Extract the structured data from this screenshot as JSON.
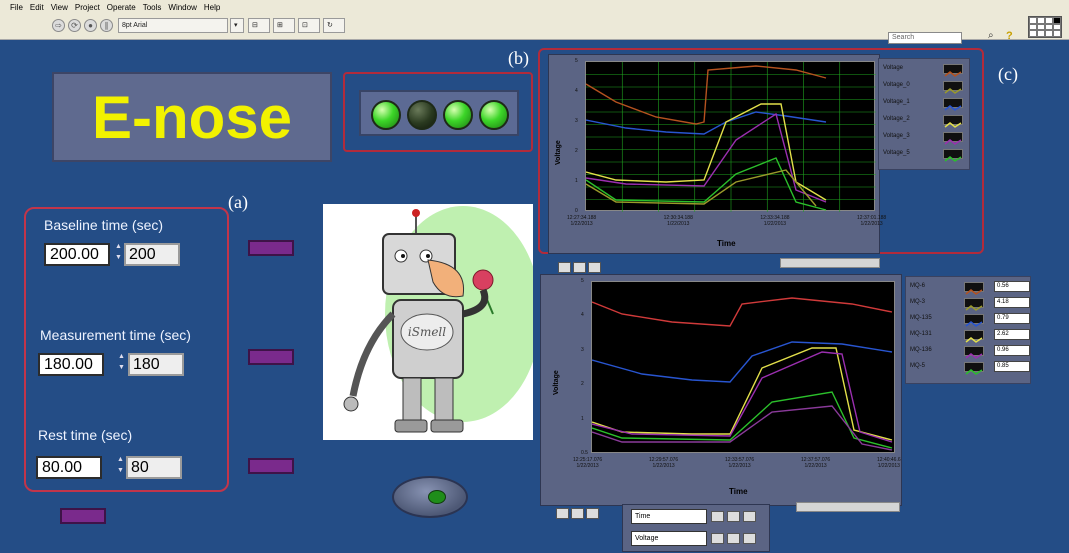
{
  "menu": [
    "File",
    "Edit",
    "View",
    "Project",
    "Operate",
    "Tools",
    "Window",
    "Help"
  ],
  "toolbar": {
    "font_select": "8pt Arial",
    "search_placeholder": "Search"
  },
  "front_panel": {
    "title": "E-nose",
    "panel_labels": {
      "a": "(a)",
      "b": "(b)",
      "c": "(c)"
    },
    "leds": [
      true,
      false,
      true,
      true
    ],
    "settings": [
      {
        "label": "Baseline time (sec)",
        "input": "200.00",
        "output": "200"
      },
      {
        "label": "Measurement time (sec)",
        "input": "180.00",
        "output": "180"
      },
      {
        "label": "Rest time (sec)",
        "input": "80.00",
        "output": "80"
      }
    ],
    "robot_text": "iSmell"
  },
  "graph_top": {
    "ylabel": "Voltage",
    "xlabel": "Time",
    "y_ticks": [
      "5",
      "4",
      "3",
      "2",
      "1",
      "0"
    ],
    "x_ticks": [
      {
        "time": "12:27:34.188",
        "date": "1/22/2013"
      },
      {
        "time": "12:30:34.188",
        "date": "1/22/2013"
      },
      {
        "time": "12:33:34.188",
        "date": "1/22/2013"
      },
      {
        "time": "12:37:01.188",
        "date": "1/22/2013"
      }
    ],
    "legend": [
      "Voltage",
      "Voltage_0",
      "Voltage_1",
      "Voltage_2",
      "Voltage_3",
      "Voltage_5"
    ]
  },
  "graph_bottom": {
    "ylabel": "Voltage",
    "xlabel": "Time",
    "y_ticks": [
      "5",
      "4",
      "3",
      "2",
      "1",
      "0.5"
    ],
    "x_ticks": [
      {
        "time": "12:25:17.076",
        "date": "1/22/2013"
      },
      {
        "time": "12:29:57.076",
        "date": "1/22/2013"
      },
      {
        "time": "12:33:57.076",
        "date": "1/22/2013"
      },
      {
        "time": "12:37:57.076",
        "date": "1/22/2013"
      },
      {
        "time": "12:40:46.6",
        "date": "1/22/2013"
      }
    ],
    "legend": [
      {
        "name": "MQ-6",
        "value": "0.56"
      },
      {
        "name": "MQ-3",
        "value": "4.18"
      },
      {
        "name": "MQ-135",
        "value": "0.79"
      },
      {
        "name": "MQ-131",
        "value": "2.62"
      },
      {
        "name": "MQ-136",
        "value": "0.96"
      },
      {
        "name": "MQ-5",
        "value": "0.85"
      }
    ],
    "controls": [
      "Time",
      "Voltage"
    ]
  },
  "colors": {
    "panel_bg": "#244d86",
    "highlight": "#b22b3b",
    "title_text": "#f2f200",
    "grid_top": "#1fa41f",
    "series": [
      "#b5521f",
      "#9a9a2a",
      "#2855d0",
      "#e2df4a",
      "#9b2fb0",
      "#2bbf2b"
    ]
  }
}
